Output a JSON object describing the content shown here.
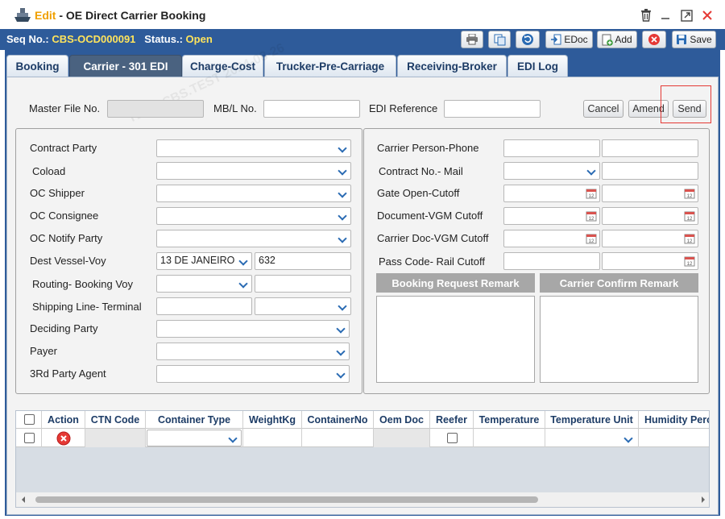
{
  "window": {
    "mode": "Edit",
    "separator": " - ",
    "title": "OE Direct Carrier Booking"
  },
  "status_bar": {
    "seq_label": "Seq No.:",
    "seq_value": "CBS-OCD000091",
    "status_label": "Status.:",
    "status_value": "Open"
  },
  "toolbar": {
    "edoc_label": "EDoc",
    "add_label": "Add",
    "save_label": "Save"
  },
  "tabs": [
    {
      "label": "Booking"
    },
    {
      "label": "Carrier - 301 EDI"
    },
    {
      "label": "Charge-Cost"
    },
    {
      "label": "Trucker-Pre-Carriage"
    },
    {
      "label": "Receiving-Broker"
    },
    {
      "label": "EDI Log"
    }
  ],
  "active_tab": "Carrier - 301 EDI",
  "header": {
    "master_file_label": "Master File No.",
    "mbl_label": "MB/L No.",
    "edi_ref_label": "EDI Reference",
    "cancel_label": "Cancel",
    "amend_label": "Amend",
    "send_label": "Send"
  },
  "left": {
    "contract_party": "Contract Party",
    "coload": "Coload",
    "oc_shipper": "OC Shipper",
    "oc_consignee": "OC Consignee",
    "oc_notify": "OC Notify Party",
    "dest_vessel": "Dest Vessel-Voy",
    "dest_vessel_value": "13 DE JANEIRO",
    "dest_voy_value": "632",
    "routing": "Routing- Booking Voy",
    "shipping_line": "Shipping Line- Terminal",
    "deciding": "Deciding Party",
    "payer": "Payer",
    "third_party": "3Rd Party Agent"
  },
  "right": {
    "carrier_person": "Carrier Person-Phone",
    "contract_no": "Contract No.- Mail",
    "gate_open": "Gate Open-Cutoff",
    "document_vgm": "Document-VGM Cutoff",
    "carrier_doc": "Carrier Doc-VGM Cutoff",
    "pass_code": "Pass Code- Rail Cutoff",
    "booking_remark": "Booking Request Remark",
    "carrier_remark": "Carrier Confirm Remark"
  },
  "grid": {
    "columns": [
      "Action",
      "CTN Code",
      "Container Type",
      "WeightKg",
      "ContainerNo",
      "Oem Doc",
      "Reefer",
      "Temperature",
      "Temperature Unit",
      "Humidity Perc"
    ]
  },
  "watermark": "TLKA.CBS.TEST 2024-08-26",
  "colors": {
    "accent": "#2e5b9a",
    "mode": "#f0a000",
    "highlight": "#ffe45c",
    "alert": "#e53935"
  }
}
